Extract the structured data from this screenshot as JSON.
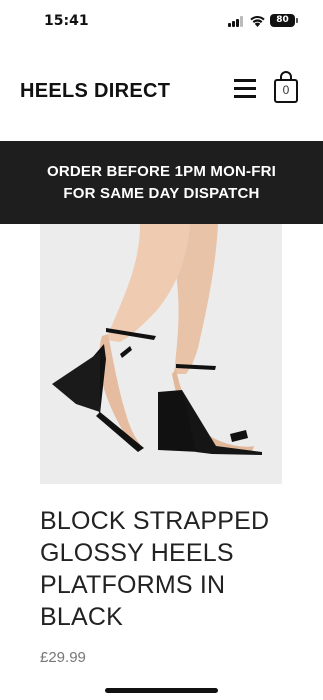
{
  "status_bar": {
    "time": "15:41",
    "battery": "80"
  },
  "header": {
    "brand": "HEELS DIRECT",
    "bag_count": "0"
  },
  "banner": {
    "line1": "ORDER BEFORE 1PM MON-FRI",
    "line2": "FOR SAME DAY DISPATCH"
  },
  "product": {
    "title": "BLOCK STRAPPED GLOSSY HEELS PLATFORMS IN BLACK",
    "price": "£29.99"
  },
  "icons": [
    "signal-icon",
    "wifi-icon",
    "battery-icon",
    "menu-icon",
    "shopping-bag-icon"
  ]
}
